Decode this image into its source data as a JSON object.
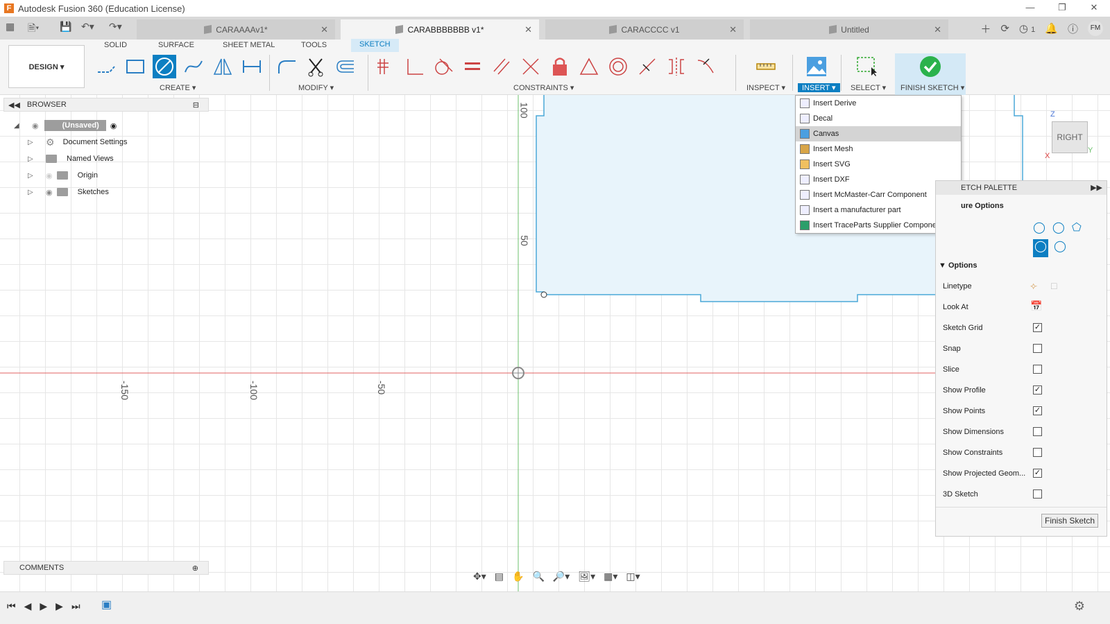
{
  "window": {
    "title": "Autodesk Fusion 360 (Education License)",
    "app_icon": "F"
  },
  "tabs": [
    {
      "label": "CARAAAAv1*",
      "active": false
    },
    {
      "label": "CARABBBBBBB v1*",
      "active": true
    },
    {
      "label": "CARACCCC v1",
      "active": false
    },
    {
      "label": "Untitled",
      "active": false
    }
  ],
  "user": {
    "initials": "FM",
    "job_count": "1"
  },
  "toolbar": {
    "design_label": "DESIGN ▾",
    "workspace_tabs": [
      "SOLID",
      "SURFACE",
      "SHEET METAL",
      "TOOLS",
      "SKETCH"
    ],
    "groups": {
      "create": "CREATE ▾",
      "modify": "MODIFY ▾",
      "constraints": "CONSTRAINTS ▾",
      "inspect": "INSPECT ▾",
      "insert": "INSERT ▾",
      "select": "SELECT ▾",
      "finish": "FINISH SKETCH ▾"
    }
  },
  "browser": {
    "title": "BROWSER",
    "root": "(Unsaved)",
    "items": [
      "Document Settings",
      "Named Views",
      "Origin",
      "Sketches"
    ]
  },
  "comments_label": "COMMENTS",
  "axis_labels": {
    "x": [
      "-150",
      "-100",
      "-50"
    ],
    "y": [
      "100",
      "50"
    ]
  },
  "viewcube": {
    "face": "RIGHT",
    "z": "Z",
    "y": "Y",
    "x": "X"
  },
  "insert_menu": [
    "Insert Derive",
    "Decal",
    "Canvas",
    "Insert Mesh",
    "Insert SVG",
    "Insert DXF",
    "Insert McMaster-Carr Component",
    "Insert a manufacturer part",
    "Insert TraceParts Supplier Components"
  ],
  "palette": {
    "title": "ETCH PALETTE",
    "feature_options": "ure Options",
    "options_header": "Options",
    "linetype": "Linetype",
    "look_at": "Look At",
    "checkboxes": [
      {
        "label": "Sketch Grid",
        "checked": true
      },
      {
        "label": "Snap",
        "checked": false
      },
      {
        "label": "Slice",
        "checked": false
      },
      {
        "label": "Show Profile",
        "checked": true
      },
      {
        "label": "Show Points",
        "checked": true
      },
      {
        "label": "Show Dimensions",
        "checked": false
      },
      {
        "label": "Show Constraints",
        "checked": false
      },
      {
        "label": "Show Projected Geom...",
        "checked": true
      },
      {
        "label": "3D Sketch",
        "checked": false
      }
    ],
    "finish_button": "Finish Sketch"
  },
  "colors": {
    "accent": "#0d7fc2",
    "profile_fill": "#e8f4fb",
    "profile_stroke": "#4aa8d8",
    "x_axis": "#e06060",
    "y_axis": "#6cc06c"
  }
}
